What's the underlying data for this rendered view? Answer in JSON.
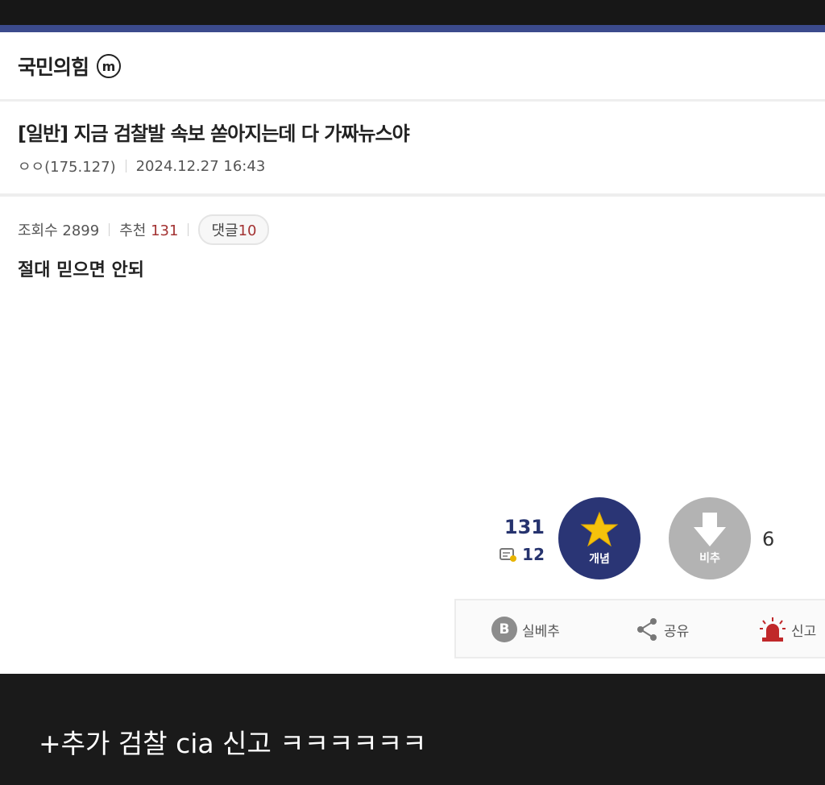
{
  "gallery": {
    "name": "국민의힘",
    "badge": "ⓜ"
  },
  "post": {
    "title": "[일반] 지금 검찰발 속보 쏟아지는데 다 가짜뉴스야",
    "author": "ㅇㅇ(175.127)",
    "datetime": "2024.12.27 16:43",
    "views_label": "조회수 2899",
    "rec_label": "추천",
    "rec_value": "131",
    "comment_label": "댓글",
    "comment_value": "10",
    "body": "절대 믿으면 안되"
  },
  "vote": {
    "rec_count": "131",
    "mini_count": "12",
    "gaenyeom_label": "개념",
    "bichu_label": "비추",
    "nonrec_count": "6"
  },
  "actions": {
    "silbechu": "실베추",
    "share": "공유",
    "report": "신고",
    "b_letter": "B"
  },
  "caption": "+추가 검찰 cia 신고 ㅋㅋㅋㅋㅋㅋ",
  "colors": {
    "accent": "#3b4a8c",
    "navy": "#2a3575",
    "recommend_red": "#a33232",
    "star": "#f5c20c",
    "report_red": "#c0282a"
  }
}
